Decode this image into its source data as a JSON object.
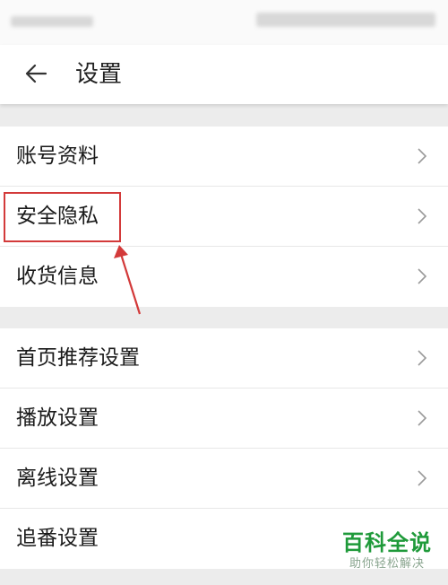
{
  "header": {
    "title": "设置",
    "back_icon": "arrow-left-icon"
  },
  "groups": [
    {
      "items": [
        {
          "label": "账号资料"
        },
        {
          "label": "安全隐私"
        },
        {
          "label": "收货信息"
        }
      ]
    },
    {
      "items": [
        {
          "label": "首页推荐设置"
        },
        {
          "label": "播放设置"
        },
        {
          "label": "离线设置"
        },
        {
          "label": "追番设置"
        }
      ]
    }
  ],
  "annotation": {
    "highlight_color": "#d33a3a",
    "highlighted_item": "安全隐私"
  },
  "watermark": {
    "title": "百科全说",
    "subtitle": "助你轻松解决"
  }
}
